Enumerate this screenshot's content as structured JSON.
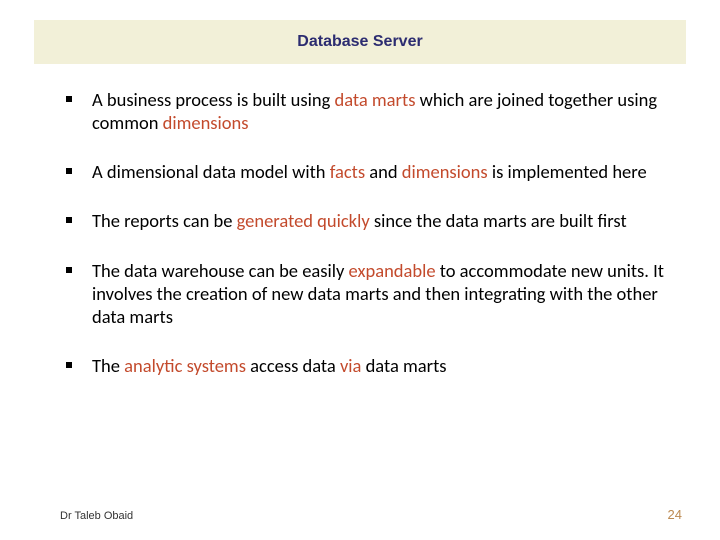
{
  "title": "Database Server",
  "bullets": [
    {
      "t0": "A business process is built using ",
      "h0": "data marts",
      "t1": " which are joined together using common ",
      "h1": "dimensions",
      "t2": ""
    },
    {
      "t0": "A dimensional data model with ",
      "h0": "facts",
      "t1": " and ",
      "h1": "dimensions",
      "t2": " is implemented here"
    },
    {
      "t0": "The reports can be ",
      "h0": "generated quickly",
      "t1": " since the data marts are built first",
      "h1": "",
      "t2": ""
    },
    {
      "t0": "The data warehouse can be easily ",
      "h0": "expandable",
      "t1": " to accommodate new units. It involves the creation of new data marts and then integrating with the other data marts",
      "h1": "",
      "t2": ""
    },
    {
      "t0": "The ",
      "h0": "analytic systems",
      "t1": " access data ",
      "h1": "via",
      "t2": " data marts"
    }
  ],
  "footer": {
    "author": "Dr Taleb Obaid",
    "page": "24"
  }
}
